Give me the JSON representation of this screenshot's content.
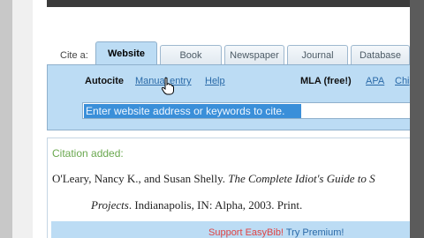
{
  "cite_label": "Cite a:",
  "tabs": [
    {
      "label": "Website",
      "active": true
    },
    {
      "label": "Book",
      "active": false
    },
    {
      "label": "Newspaper",
      "active": false
    },
    {
      "label": "Journal",
      "active": false
    },
    {
      "label": "Database",
      "active": false
    }
  ],
  "options": {
    "autocite": "Autocite",
    "manual_entry": "Manual entry",
    "help": "Help",
    "style": "MLA (free!)",
    "apa": "APA",
    "chicago": "Chi"
  },
  "search": {
    "value": "Enter website address or keywords to cite."
  },
  "result": {
    "status": "Citation added:",
    "line1_plain": "O'Leary, Nancy K., and Susan Shelly. ",
    "line1_italic": "The Complete Idiot's Guide to S",
    "line2_italic": "Projects",
    "line2_plain": ". Indianapolis, IN: Alpha, 2003. Print."
  },
  "support": {
    "text_a": "Support EasyBib!",
    "text_b": "Try Premium!"
  },
  "colors": {
    "panel": "#bcdcf4",
    "link": "#2a6aa8",
    "status_green": "#6aa84f",
    "selection": "#3a8fd9"
  },
  "icons": {
    "cursor": "hand-pointer-icon"
  }
}
